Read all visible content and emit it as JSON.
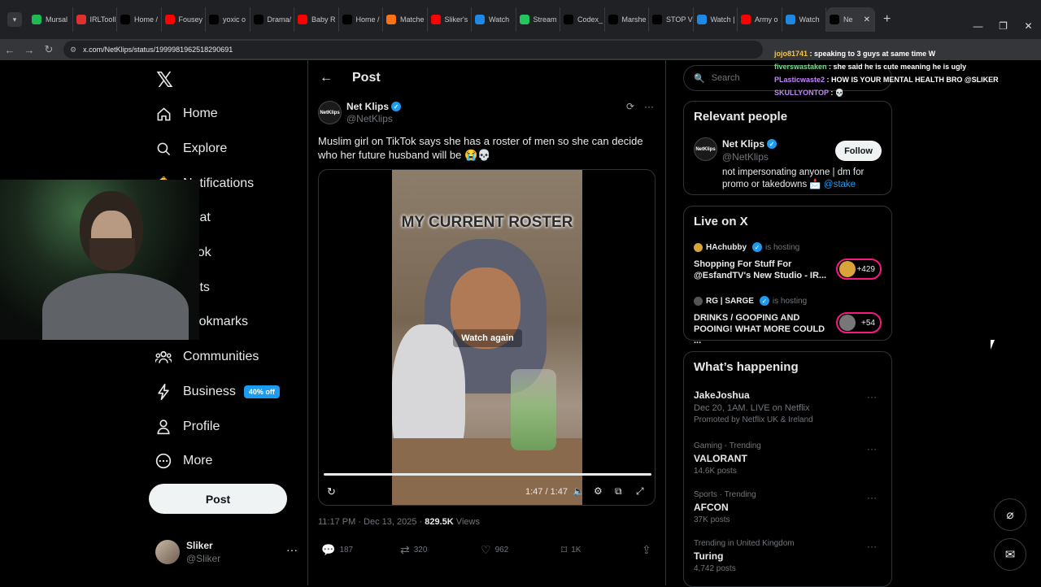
{
  "browser": {
    "tabs": [
      {
        "label": "Mursal",
        "color": "#1db954"
      },
      {
        "label": "IRLTooll",
        "color": "#e03131"
      },
      {
        "label": "Home /",
        "color": "#000000"
      },
      {
        "label": "Fousey",
        "color": "#ff0000"
      },
      {
        "label": "yoxic o",
        "color": "#000000"
      },
      {
        "label": "Drama/",
        "color": "#000000"
      },
      {
        "label": "Baby R",
        "color": "#ff0000"
      },
      {
        "label": "Home /",
        "color": "#000000"
      },
      {
        "label": "Matche",
        "color": "#f97316"
      },
      {
        "label": "Sliker's",
        "color": "#ff0000"
      },
      {
        "label": "Watch",
        "color": "#1e88e5"
      },
      {
        "label": "Stream",
        "color": "#22c55e"
      },
      {
        "label": "Codex_",
        "color": "#000000"
      },
      {
        "label": "Marshe",
        "color": "#000000"
      },
      {
        "label": "STOP V",
        "color": "#000000"
      },
      {
        "label": "Watch |",
        "color": "#1e88e5"
      },
      {
        "label": "Army o",
        "color": "#ff0000"
      },
      {
        "label": "Watch",
        "color": "#1e88e5"
      },
      {
        "label": "Ne",
        "color": "#000000",
        "active": true
      }
    ],
    "url": "x.com/NetKlips/status/1999981962518290691"
  },
  "chat": [
    {
      "user": "jojo81741",
      "msg": "speaking to 3 guys at same time W",
      "color": "#f5c542"
    },
    {
      "user": "fiverswastaken",
      "msg": "she said he is cute meaning he is ugly",
      "color": "#7bd88f"
    },
    {
      "user": "PLasticwaste2",
      "msg": "HOW IS YOUR MENTAL HEALTH BRO @SLIKER",
      "color": "#c084fc"
    },
    {
      "user": "SKULLYONTOP",
      "msg": "💀",
      "color": "#c084fc"
    }
  ],
  "nav": {
    "items": [
      "Home",
      "Explore",
      "Notifications",
      "Chat",
      "Grok",
      "Lists",
      "Bookmarks",
      "Communities",
      "Business",
      "Profile",
      "More"
    ],
    "business_badge": "40% off",
    "post_button": "Post",
    "user_name": "Sliker",
    "user_handle": "@Sliker"
  },
  "post": {
    "header_title": "Post",
    "author_name": "Net Klips",
    "author_handle": "@NetKlips",
    "avatar_text": "NetKlips",
    "text": "Muslim girl on TikTok says she has a roster of men so she can decide who her future husband will be 😭💀",
    "video_caption": "MY CURRENT ROSTER",
    "watch_again": "Watch again",
    "time": "1:47 / 1:47",
    "progress": 1.0,
    "timestamp": "11:17 PM · Dec 13, 2025 · ",
    "views": "829.5K",
    "views_label": " Views",
    "replies": "187",
    "reposts": "320",
    "likes": "962",
    "bookmarks": "1K"
  },
  "sidebar": {
    "search_placeholder": "Search",
    "relevant_title": "Relevant people",
    "rp_name": "Net Klips",
    "rp_handle": "@NetKlips",
    "follow_label": "Follow",
    "rp_bio": "not impersonating anyone | dm for promo or takedowns 📩 ",
    "rp_bio_link": "@stake",
    "live_title": "Live on X",
    "live": [
      {
        "host": "HAchubby",
        "hosting": "is hosting",
        "title": "Shopping For Stuff For @EsfandTV's New Studio - IR...",
        "count": "+429"
      },
      {
        "host": "RG | SARGE",
        "hosting": "is hosting",
        "title": "DRINKS / GOOPING AND POOING! WHAT MORE COULD ...",
        "count": "+54"
      }
    ],
    "happening_title": "What’s happening",
    "trends": [
      {
        "title": "JakeJoshua",
        "sub": "Dec 20, 1AM. LIVE on Netflix",
        "promo": "Promoted by Netflix UK & Ireland"
      },
      {
        "category": "Gaming · Trending",
        "title": "VALORANT",
        "posts": "14.6K posts"
      },
      {
        "category": "Sports · Trending",
        "title": "AFCON",
        "posts": "37K posts"
      },
      {
        "category": "Trending in United Kingdom",
        "title": "Turing",
        "posts": "4,742 posts"
      }
    ]
  }
}
